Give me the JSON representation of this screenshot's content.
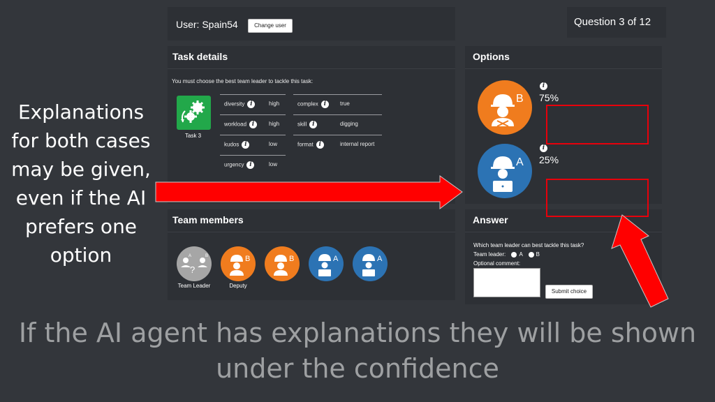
{
  "header": {
    "user_label": "User: Spain54",
    "change_user_label": "Change user",
    "question_counter": "Question 3 of 12"
  },
  "task": {
    "title": "Task details",
    "prompt": "You must choose the best team leader to tackle this task:",
    "task_name": "Task 3",
    "task_icon": "gears-icon",
    "attributes_left": [
      {
        "key": "diversity",
        "value": "high"
      },
      {
        "key": "workload",
        "value": "high"
      },
      {
        "key": "kudos",
        "value": "low"
      },
      {
        "key": "urgency",
        "value": "low"
      }
    ],
    "attributes_right": [
      {
        "key": "complex",
        "value": "true"
      },
      {
        "key": "skill",
        "value": "digging"
      },
      {
        "key": "format",
        "value": "internal report"
      }
    ]
  },
  "options": {
    "title": "Options",
    "items": [
      {
        "letter": "B",
        "confidence": "75%",
        "color": "#f07c1e"
      },
      {
        "letter": "A",
        "confidence": "25%",
        "color": "#2c73b4"
      }
    ]
  },
  "team": {
    "title": "Team members",
    "members": [
      {
        "role": "Team Leader",
        "kind": "unknown",
        "letter": "?"
      },
      {
        "role": "Deputy",
        "kind": "B",
        "letter": "B"
      },
      {
        "role": "",
        "kind": "B",
        "letter": "B"
      },
      {
        "role": "",
        "kind": "A",
        "letter": "A"
      },
      {
        "role": "",
        "kind": "A",
        "letter": "A"
      }
    ]
  },
  "answer": {
    "title": "Answer",
    "question": "Which team leader can best tackle this task?",
    "leader_label": "Team leader:",
    "option_a": "A",
    "option_b": "B",
    "comment_label": "Optional comment:",
    "submit_label": "Submit choice"
  },
  "overlay": {
    "side_text": "Explanations for both cases may be given, even if the AI prefers one option",
    "bottom_text": "If the AI agent has explanations they will be shown under the confidence",
    "arrow_color": "#ff0000",
    "box_color": "#e8000b"
  }
}
